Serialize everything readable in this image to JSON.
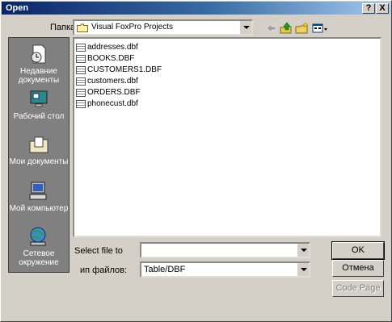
{
  "window": {
    "title": "Open",
    "help_glyph": "?",
    "close_glyph": "X"
  },
  "lookin": {
    "label": "Папка:",
    "value": "Visual FoxPro Projects"
  },
  "toolbar": {
    "back_icon": "back-arrow-icon",
    "up_icon": "up-folder-icon",
    "new_icon": "new-folder-icon",
    "views_icon": "views-menu-icon"
  },
  "places": [
    {
      "label": "Недавние документы",
      "icon": "recent-documents-icon"
    },
    {
      "label": "Рабочий стол",
      "icon": "desktop-icon"
    },
    {
      "label": "Мои документы",
      "icon": "my-documents-icon"
    },
    {
      "label": "Мой компьютер",
      "icon": "my-computer-icon"
    },
    {
      "label": "Сетевое окружение",
      "icon": "network-icon"
    }
  ],
  "files": [
    "addresses.dbf",
    "BOOKS.DBF",
    "CUSTOMERS1.DBF",
    "customers.dbf",
    "ORDERS.DBF",
    "phonecust.dbf"
  ],
  "select_file": {
    "label": "Select file to",
    "value": ""
  },
  "file_type": {
    "label": "ип файлов:",
    "value": "Table/DBF"
  },
  "buttons": {
    "ok": "OK",
    "cancel": "Отмена",
    "code_page": "Code Page"
  }
}
